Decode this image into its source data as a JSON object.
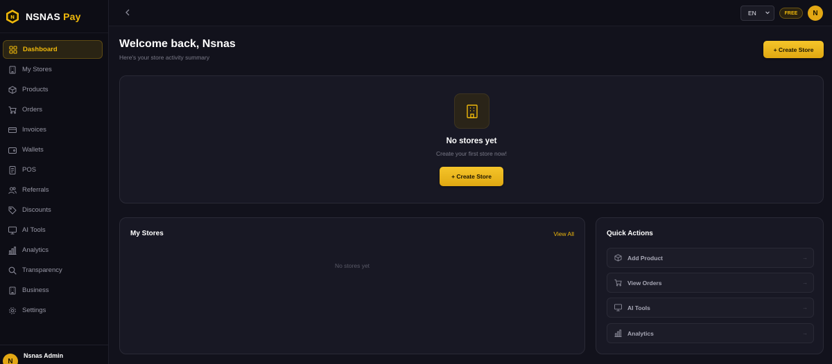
{
  "brand": {
    "name": "NSNAS",
    "suffix": "Pay",
    "accent": "#f0b90b"
  },
  "sidebar": {
    "items": [
      {
        "label": "Dashboard",
        "icon": "grid-icon",
        "active": true
      },
      {
        "label": "My Stores",
        "icon": "building-icon"
      },
      {
        "label": "Products",
        "icon": "box-icon"
      },
      {
        "label": "Orders",
        "icon": "cart-icon"
      },
      {
        "label": "Invoices",
        "icon": "card-icon"
      },
      {
        "label": "Wallets",
        "icon": "wallet-icon"
      },
      {
        "label": "POS",
        "icon": "pos-icon"
      },
      {
        "label": "Referrals",
        "icon": "users-icon"
      },
      {
        "label": "Discounts",
        "icon": "tag-icon"
      },
      {
        "label": "AI Tools",
        "icon": "monitor-icon"
      },
      {
        "label": "Analytics",
        "icon": "bar-chart-icon"
      },
      {
        "label": "Transparency",
        "icon": "search-icon"
      },
      {
        "label": "Business",
        "icon": "building-icon"
      },
      {
        "label": "Settings",
        "icon": "gear-icon"
      }
    ],
    "user": {
      "initial": "N",
      "name": "Nsnas Admin"
    }
  },
  "topbar": {
    "language": "EN",
    "plan_badge": "FREE",
    "avatar_initial": "N"
  },
  "header": {
    "title": "Welcome back, Nsnas",
    "subtitle": "Here's your store activity summary",
    "create_button": "+ Create Store"
  },
  "empty_state": {
    "title": "No stores yet",
    "subtitle": "Create your first store now!",
    "button": "+ Create Store"
  },
  "my_stores": {
    "title": "My Stores",
    "view_all": "View All",
    "empty_text": "No stores yet"
  },
  "quick_actions": {
    "title": "Quick Actions",
    "items": [
      {
        "label": "Add Product",
        "icon": "box-icon",
        "arrow": "→"
      },
      {
        "label": "View Orders",
        "icon": "cart-icon",
        "arrow": "→"
      },
      {
        "label": "AI Tools",
        "icon": "monitor-icon",
        "arrow": "→"
      },
      {
        "label": "Analytics",
        "icon": "bar-chart-icon",
        "arrow": "→"
      }
    ]
  }
}
